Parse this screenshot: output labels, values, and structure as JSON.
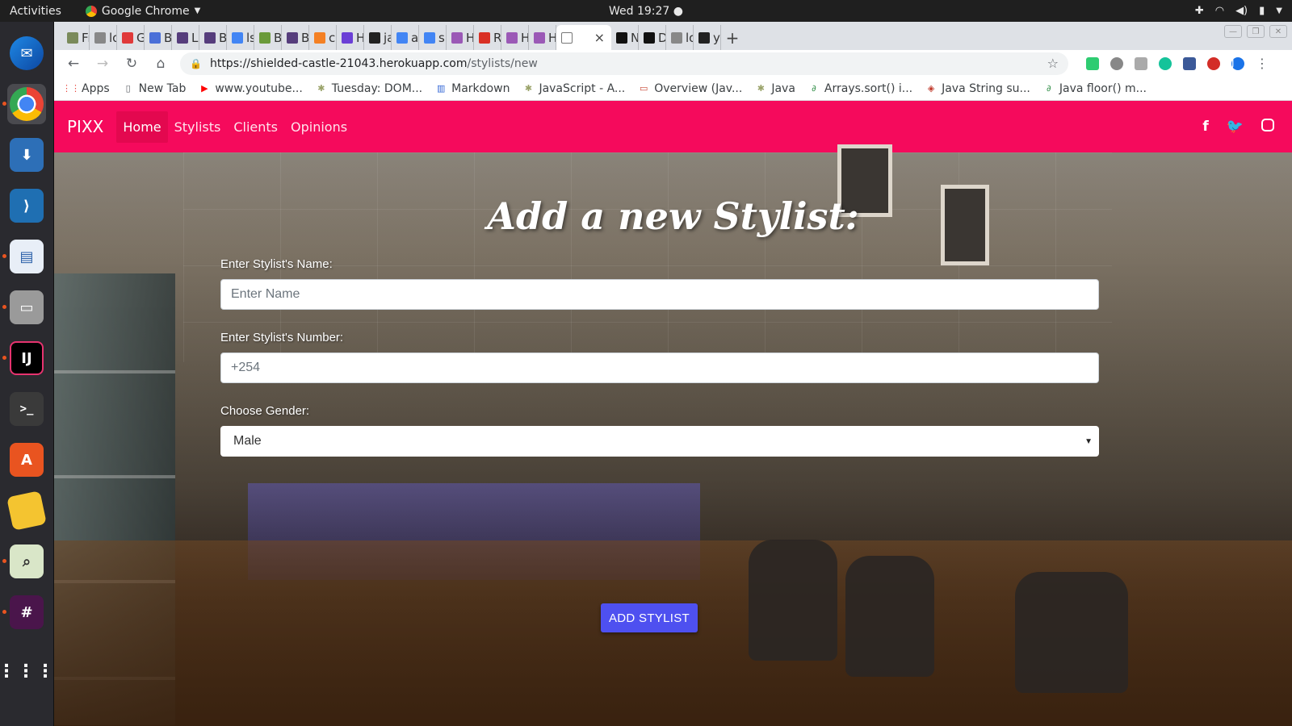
{
  "system": {
    "activities": "Activities",
    "app_name": "Google Chrome",
    "clock": "Wed 19:27 ●"
  },
  "browser": {
    "tabs": [
      {
        "label": "Fri",
        "color": "#7a8a5a"
      },
      {
        "label": "loc",
        "color": "#888888"
      },
      {
        "label": "Go",
        "color": "#e03a3a"
      },
      {
        "label": "Bo",
        "color": "#4a6fd8"
      },
      {
        "label": "Lis",
        "color": "#563d7c"
      },
      {
        "label": "Bu",
        "color": "#563d7c"
      },
      {
        "label": "lst",
        "color": "#4285f4"
      },
      {
        "label": "Bo",
        "color": "#6a9a3a"
      },
      {
        "label": "Bu",
        "color": "#563d7c"
      },
      {
        "label": "css",
        "color": "#f48024"
      },
      {
        "label": "Ho",
        "color": "#6b3fd6"
      },
      {
        "label": "jac",
        "color": "#222222"
      },
      {
        "label": "ap",
        "color": "#4285f4"
      },
      {
        "label": "src",
        "color": "#4285f4"
      },
      {
        "label": "He",
        "color": "#9b59b6"
      },
      {
        "label": "Re",
        "color": "#d93025"
      },
      {
        "label": "He",
        "color": "#9b59b6"
      },
      {
        "label": "He",
        "color": "#9b59b6"
      }
    ],
    "active_tab_close": "×",
    "tabs_after": [
      {
        "label": "No",
        "color": "#111111"
      },
      {
        "label": "De",
        "color": "#111111"
      },
      {
        "label": "loc",
        "color": "#888888"
      },
      {
        "label": "ya",
        "color": "#222222"
      }
    ],
    "new_tab": "+",
    "url_host": "https://shielded-castle-21043.herokuapp.com",
    "url_path": "/stylists/new",
    "profile_initial": "J",
    "bookmarks": [
      {
        "label": "Apps",
        "icon": "apps-grid-icon"
      },
      {
        "label": "New Tab",
        "icon": "page-icon"
      },
      {
        "label": "www.youtube...",
        "icon": "youtube-icon"
      },
      {
        "label": "Tuesday: DOM...",
        "icon": "palm-icon"
      },
      {
        "label": "Markdown",
        "icon": "markdown-icon"
      },
      {
        "label": "JavaScript - A...",
        "icon": "palm-icon"
      },
      {
        "label": "Overview (Jav...",
        "icon": "oracle-icon"
      },
      {
        "label": "Java",
        "icon": "palm-icon"
      },
      {
        "label": "Arrays.sort() i...",
        "icon": "gfg-icon"
      },
      {
        "label": "Java String su...",
        "icon": "tutorial-icon"
      },
      {
        "label": "Java floor() m...",
        "icon": "gfg-icon"
      }
    ]
  },
  "site": {
    "brand": "PIXX",
    "nav": [
      "Home",
      "Stylists",
      "Clients",
      "Opinions"
    ],
    "active_nav": "Home",
    "accent": "#f50a5c",
    "heading": "Add a new Stylist:",
    "form": {
      "name_label": "Enter Stylist's Name:",
      "name_placeholder": "Enter Name",
      "number_label": "Enter Stylist's Number:",
      "number_placeholder": "+254",
      "gender_label": "Choose Gender:",
      "gender_value": "Male",
      "submit": "ADD STYLIST",
      "submit_color": "#4e50f0"
    }
  }
}
